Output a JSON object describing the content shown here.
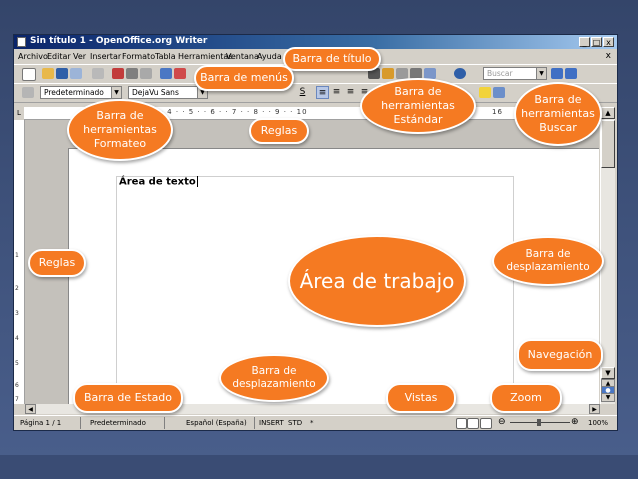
{
  "window": {
    "title": "Sin título 1 - OpenOffice.org Writer",
    "controls": [
      "_",
      "□",
      "x"
    ]
  },
  "menu": {
    "items": [
      "Archivo",
      "Editar",
      "Ver",
      "Insertar",
      "Formato",
      "Tabla",
      "Herramientas",
      "Ventana",
      "Ayuda"
    ],
    "close": "x"
  },
  "toolbar_standard": {
    "search_placeholder": "Buscar"
  },
  "toolbar_format": {
    "paragraph_style": "Predeterminado",
    "font_name": "DejaVu Sans",
    "underline_symbol": "S"
  },
  "ruler": {
    "numbers": "1 · · 3 · · 4 · · 5 · · 6 · · 7 · · 8 · · 9 · · 10",
    "end_number": "16",
    "vertical_numbers": [
      "1",
      "2",
      "3",
      "4",
      "5",
      "6",
      "7"
    ]
  },
  "document": {
    "text": "Área de texto"
  },
  "statusbar": {
    "page": "Página 1 / 1",
    "style": "Predeterminado",
    "language": "Español (España)",
    "mode": "INSERT",
    "selection": "STD",
    "modified": "*",
    "zoom": "100%"
  },
  "callouts": {
    "title_bar": "Barra de título",
    "menu_bar": "Barra de menús",
    "standard_toolbar": "Barra de herramientas Estándar",
    "search_toolbar": "Barra de herramientas Buscar",
    "format_toolbar": "Barra de herramientas Formateo",
    "rulers_top": "Reglas",
    "rulers_left": "Reglas",
    "work_area": "Área de trabajo",
    "vertical_scroll": "Barra de desplazamiento",
    "navigation": "Navegación",
    "horizontal_scroll": "Barra de desplazamiento",
    "status_bar": "Barra de Estado",
    "views": "Vistas",
    "zoom": "Zoom"
  },
  "colors": {
    "callout": "#f57a22",
    "background": "#3d5079",
    "titlebar": "#0a246a"
  }
}
